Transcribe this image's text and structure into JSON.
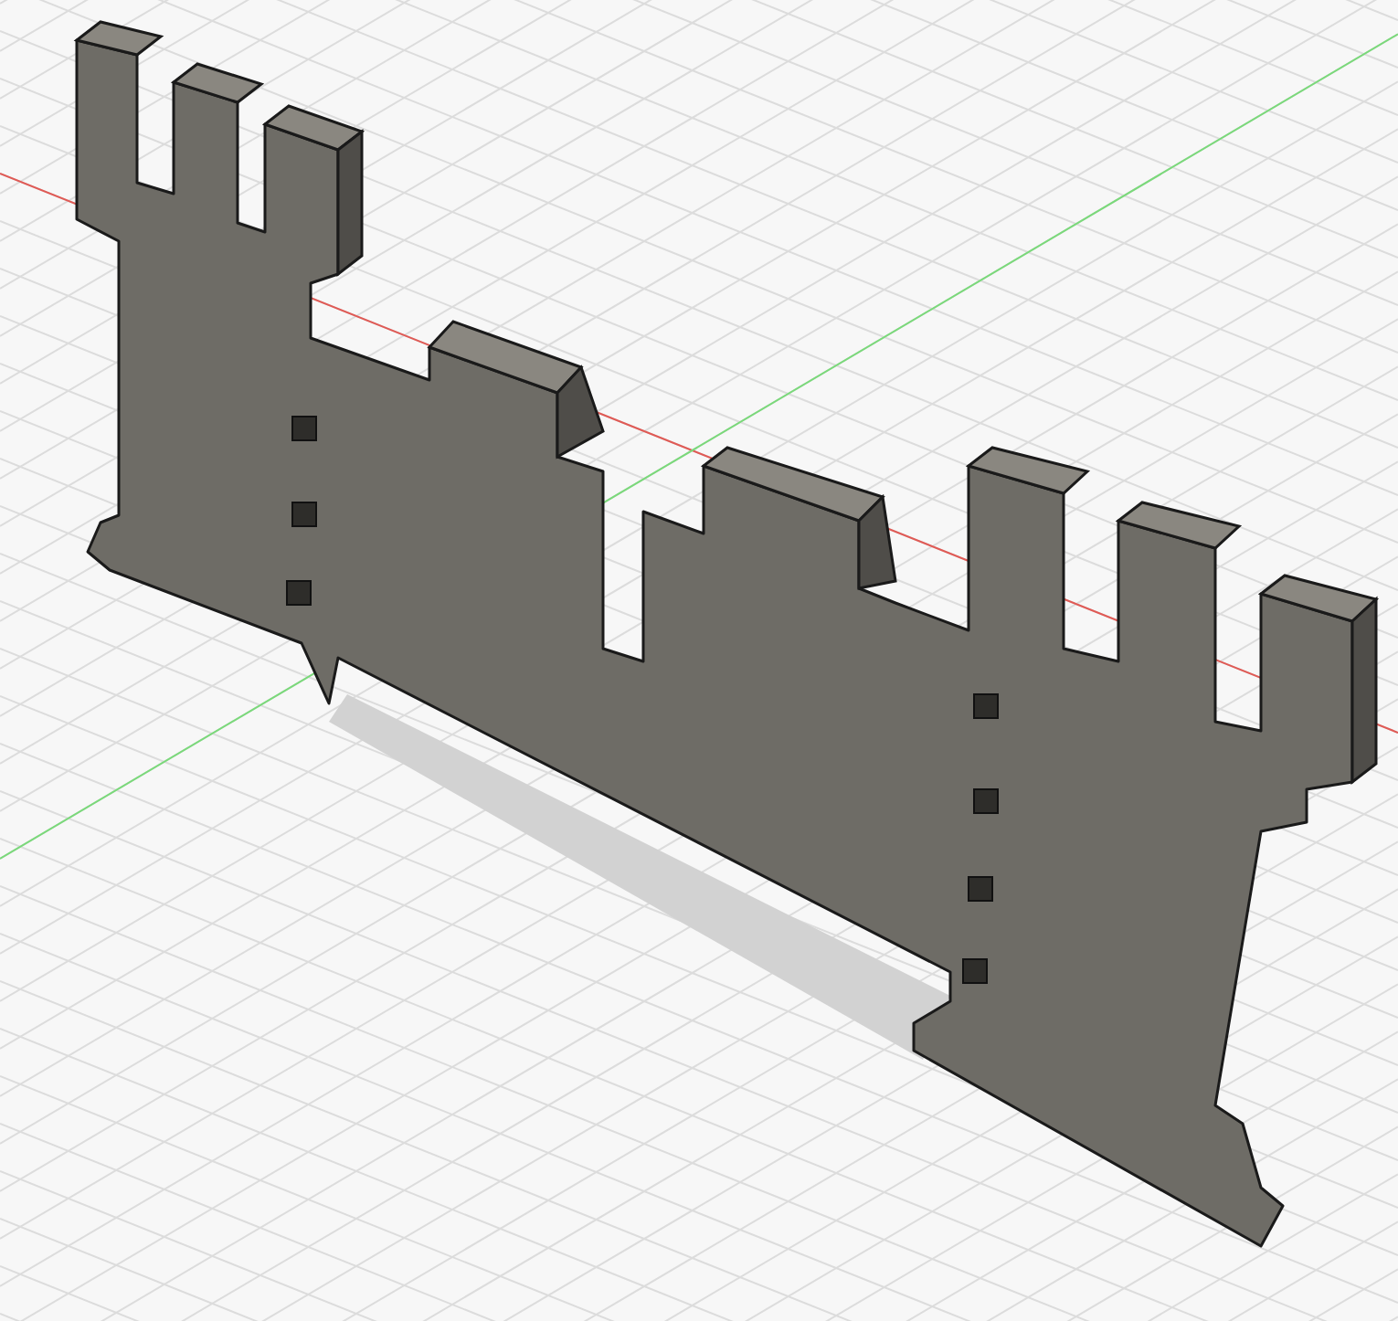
{
  "viewport": {
    "axes": [
      {
        "kind": "x",
        "color": "#e05a55"
      },
      {
        "kind": "y",
        "color": "#7ad97a"
      }
    ]
  }
}
